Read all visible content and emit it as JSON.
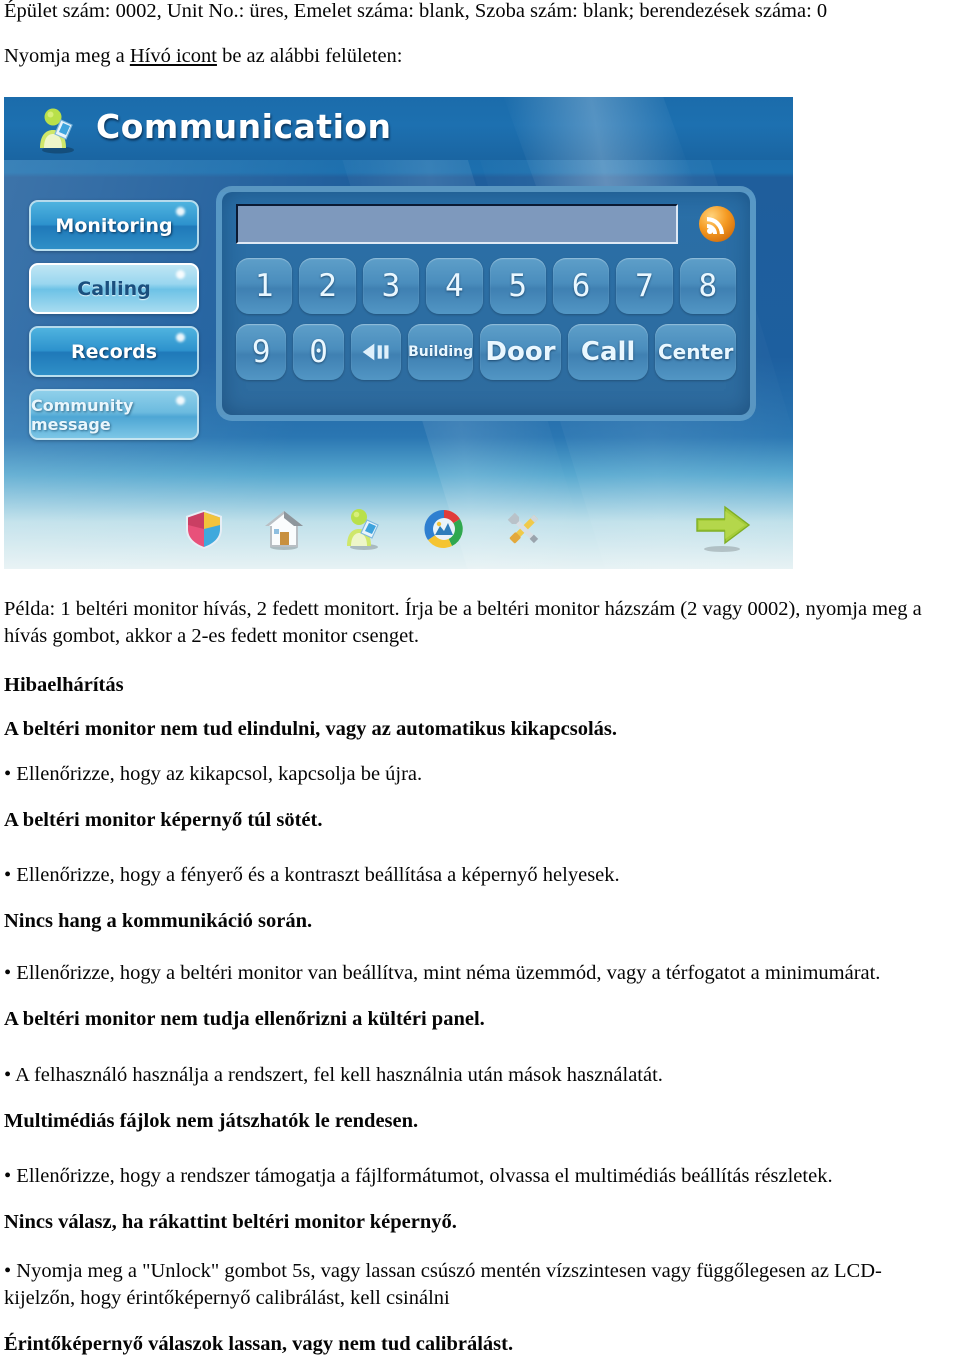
{
  "document": {
    "line_building": "Épület szám: 0002, Unit No.: üres, Emelet száma: blank, Szoba szám: blank; berendezések száma: 0",
    "line_press_icon_prefix": "Nyomja meg a ",
    "line_press_icon_link": "Hívó icont",
    "line_press_icon_suffix": " be az alábbi felületen:",
    "line_example": "Példa: 1 beltéri monitor hívás, 2 fedett monitort. Írja be a beltéri monitor házszám (2 vagy 0002), nyomja meg a hívás gombot, akkor a 2-es fedett monitor csenget.",
    "heading_troubleshooting": "Hibaelhárítás",
    "heading_cannot_start": "A beltéri monitor nem tud elindulni, vagy az automatikus kikapcsolás.",
    "bullet_power_cycle": "• Ellenőrizze, hogy az kikapcsol, kapcsolja be újra.",
    "heading_screen_dark": "A beltéri monitor képernyő túl sötét.",
    "bullet_brightness": "• Ellenőrizze, hogy a fényerő és a kontraszt beállítása a képernyő helyesek.",
    "heading_no_sound": "Nincs hang a kommunikáció során.",
    "bullet_mute_volume": "• Ellenőrizze, hogy a beltéri monitor van beállítva, mint néma üzemmód, vagy a térfogatot a minimumárat.",
    "heading_no_outdoor": "A beltéri monitor nem tudja ellenőrizni a kültéri panel.",
    "bullet_user_system": "• A felhasználó használja a rendszert, fel kell használnia után mások használatát.",
    "heading_multimedia": "Multimédiás fájlok nem játszhatók le rendesen.",
    "bullet_fileformat": "• Ellenőrizze, hogy a rendszer támogatja a fájlformátumot, olvassa el multimédiás beállítás részletek.",
    "heading_no_response": "Nincs válasz, ha rákattint beltéri monitor képernyő.",
    "bullet_unlock": "• Nyomja meg a \"Unlock\" gombot 5s, vagy lassan csúszó mentén vízszintesen vagy függőlegesen az LCD-kijelzőn, hogy érintőképernyő calibrálást, kell csinálni",
    "heading_slow_response": "Érintőképernyő válaszok lassan, vagy nem tud calibrálást."
  },
  "device_screen": {
    "title": "Communication",
    "app_icon": "user-communication-icon",
    "menu": [
      {
        "label": "Monitoring",
        "state": "normal",
        "icon": "monitoring-button"
      },
      {
        "label": "Calling",
        "state": "active",
        "icon": "calling-button"
      },
      {
        "label": "Records",
        "state": "normal",
        "icon": "records-button"
      },
      {
        "label": "Community message",
        "state": "dim",
        "icon": "community-message-button"
      }
    ],
    "display": {
      "value": "",
      "placeholder": ""
    },
    "signal_icon": "rss-signal-icon",
    "keypad_row1": [
      {
        "label": "1",
        "name": "key-1",
        "type": "digit"
      },
      {
        "label": "2",
        "name": "key-2",
        "type": "digit"
      },
      {
        "label": "3",
        "name": "key-3",
        "type": "digit"
      },
      {
        "label": "4",
        "name": "key-4",
        "type": "digit"
      },
      {
        "label": "5",
        "name": "key-5",
        "type": "digit"
      },
      {
        "label": "6",
        "name": "key-6",
        "type": "digit"
      },
      {
        "label": "7",
        "name": "key-7",
        "type": "digit"
      },
      {
        "label": "8",
        "name": "key-8",
        "type": "digit"
      }
    ],
    "keypad_row2": [
      {
        "label": "9",
        "name": "key-9",
        "type": "digit"
      },
      {
        "label": "0",
        "name": "key-0",
        "type": "digit"
      },
      {
        "label": "◀❙❙",
        "name": "backspace-icon",
        "type": "back"
      },
      {
        "label": "Building",
        "name": "key-building",
        "type": "building"
      },
      {
        "label": "Door",
        "name": "key-door",
        "type": "door"
      },
      {
        "label": "Call",
        "name": "key-call",
        "type": "call"
      },
      {
        "label": "Center",
        "name": "key-center",
        "type": "center"
      }
    ],
    "dock_icons": [
      "security-shield-icon",
      "home-house-icon",
      "communication-person-icon",
      "multimedia-globe-icon",
      "settings-tools-icon"
    ],
    "dock_next_icon": "next-arrow-icon",
    "colors": {
      "title_bar": "#1d70b0",
      "panel": "#2b6ea4",
      "key": "#4a8dbd",
      "active_menu": "#9ad6ef",
      "accent_orange": "#f59a22",
      "next_arrow_green": "#a6cd3a"
    }
  }
}
